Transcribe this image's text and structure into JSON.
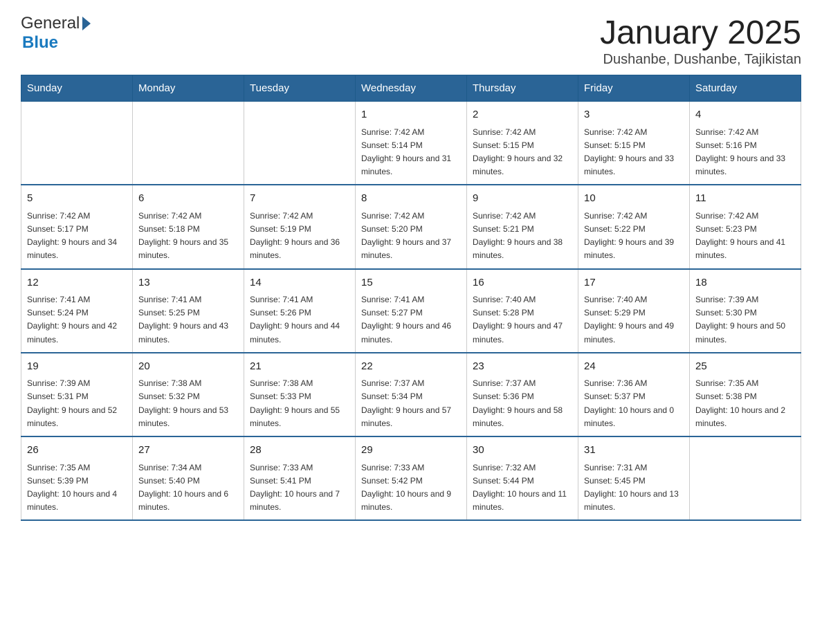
{
  "header": {
    "title": "January 2025",
    "subtitle": "Dushanbe, Dushanbe, Tajikistan",
    "logo_general": "General",
    "logo_blue": "Blue"
  },
  "days_of_week": [
    "Sunday",
    "Monday",
    "Tuesday",
    "Wednesday",
    "Thursday",
    "Friday",
    "Saturday"
  ],
  "weeks": [
    {
      "days": [
        {
          "number": "",
          "info": ""
        },
        {
          "number": "",
          "info": ""
        },
        {
          "number": "",
          "info": ""
        },
        {
          "number": "1",
          "info": "Sunrise: 7:42 AM\nSunset: 5:14 PM\nDaylight: 9 hours and 31 minutes."
        },
        {
          "number": "2",
          "info": "Sunrise: 7:42 AM\nSunset: 5:15 PM\nDaylight: 9 hours and 32 minutes."
        },
        {
          "number": "3",
          "info": "Sunrise: 7:42 AM\nSunset: 5:15 PM\nDaylight: 9 hours and 33 minutes."
        },
        {
          "number": "4",
          "info": "Sunrise: 7:42 AM\nSunset: 5:16 PM\nDaylight: 9 hours and 33 minutes."
        }
      ]
    },
    {
      "days": [
        {
          "number": "5",
          "info": "Sunrise: 7:42 AM\nSunset: 5:17 PM\nDaylight: 9 hours and 34 minutes."
        },
        {
          "number": "6",
          "info": "Sunrise: 7:42 AM\nSunset: 5:18 PM\nDaylight: 9 hours and 35 minutes."
        },
        {
          "number": "7",
          "info": "Sunrise: 7:42 AM\nSunset: 5:19 PM\nDaylight: 9 hours and 36 minutes."
        },
        {
          "number": "8",
          "info": "Sunrise: 7:42 AM\nSunset: 5:20 PM\nDaylight: 9 hours and 37 minutes."
        },
        {
          "number": "9",
          "info": "Sunrise: 7:42 AM\nSunset: 5:21 PM\nDaylight: 9 hours and 38 minutes."
        },
        {
          "number": "10",
          "info": "Sunrise: 7:42 AM\nSunset: 5:22 PM\nDaylight: 9 hours and 39 minutes."
        },
        {
          "number": "11",
          "info": "Sunrise: 7:42 AM\nSunset: 5:23 PM\nDaylight: 9 hours and 41 minutes."
        }
      ]
    },
    {
      "days": [
        {
          "number": "12",
          "info": "Sunrise: 7:41 AM\nSunset: 5:24 PM\nDaylight: 9 hours and 42 minutes."
        },
        {
          "number": "13",
          "info": "Sunrise: 7:41 AM\nSunset: 5:25 PM\nDaylight: 9 hours and 43 minutes."
        },
        {
          "number": "14",
          "info": "Sunrise: 7:41 AM\nSunset: 5:26 PM\nDaylight: 9 hours and 44 minutes."
        },
        {
          "number": "15",
          "info": "Sunrise: 7:41 AM\nSunset: 5:27 PM\nDaylight: 9 hours and 46 minutes."
        },
        {
          "number": "16",
          "info": "Sunrise: 7:40 AM\nSunset: 5:28 PM\nDaylight: 9 hours and 47 minutes."
        },
        {
          "number": "17",
          "info": "Sunrise: 7:40 AM\nSunset: 5:29 PM\nDaylight: 9 hours and 49 minutes."
        },
        {
          "number": "18",
          "info": "Sunrise: 7:39 AM\nSunset: 5:30 PM\nDaylight: 9 hours and 50 minutes."
        }
      ]
    },
    {
      "days": [
        {
          "number": "19",
          "info": "Sunrise: 7:39 AM\nSunset: 5:31 PM\nDaylight: 9 hours and 52 minutes."
        },
        {
          "number": "20",
          "info": "Sunrise: 7:38 AM\nSunset: 5:32 PM\nDaylight: 9 hours and 53 minutes."
        },
        {
          "number": "21",
          "info": "Sunrise: 7:38 AM\nSunset: 5:33 PM\nDaylight: 9 hours and 55 minutes."
        },
        {
          "number": "22",
          "info": "Sunrise: 7:37 AM\nSunset: 5:34 PM\nDaylight: 9 hours and 57 minutes."
        },
        {
          "number": "23",
          "info": "Sunrise: 7:37 AM\nSunset: 5:36 PM\nDaylight: 9 hours and 58 minutes."
        },
        {
          "number": "24",
          "info": "Sunrise: 7:36 AM\nSunset: 5:37 PM\nDaylight: 10 hours and 0 minutes."
        },
        {
          "number": "25",
          "info": "Sunrise: 7:35 AM\nSunset: 5:38 PM\nDaylight: 10 hours and 2 minutes."
        }
      ]
    },
    {
      "days": [
        {
          "number": "26",
          "info": "Sunrise: 7:35 AM\nSunset: 5:39 PM\nDaylight: 10 hours and 4 minutes."
        },
        {
          "number": "27",
          "info": "Sunrise: 7:34 AM\nSunset: 5:40 PM\nDaylight: 10 hours and 6 minutes."
        },
        {
          "number": "28",
          "info": "Sunrise: 7:33 AM\nSunset: 5:41 PM\nDaylight: 10 hours and 7 minutes."
        },
        {
          "number": "29",
          "info": "Sunrise: 7:33 AM\nSunset: 5:42 PM\nDaylight: 10 hours and 9 minutes."
        },
        {
          "number": "30",
          "info": "Sunrise: 7:32 AM\nSunset: 5:44 PM\nDaylight: 10 hours and 11 minutes."
        },
        {
          "number": "31",
          "info": "Sunrise: 7:31 AM\nSunset: 5:45 PM\nDaylight: 10 hours and 13 minutes."
        },
        {
          "number": "",
          "info": ""
        }
      ]
    }
  ]
}
